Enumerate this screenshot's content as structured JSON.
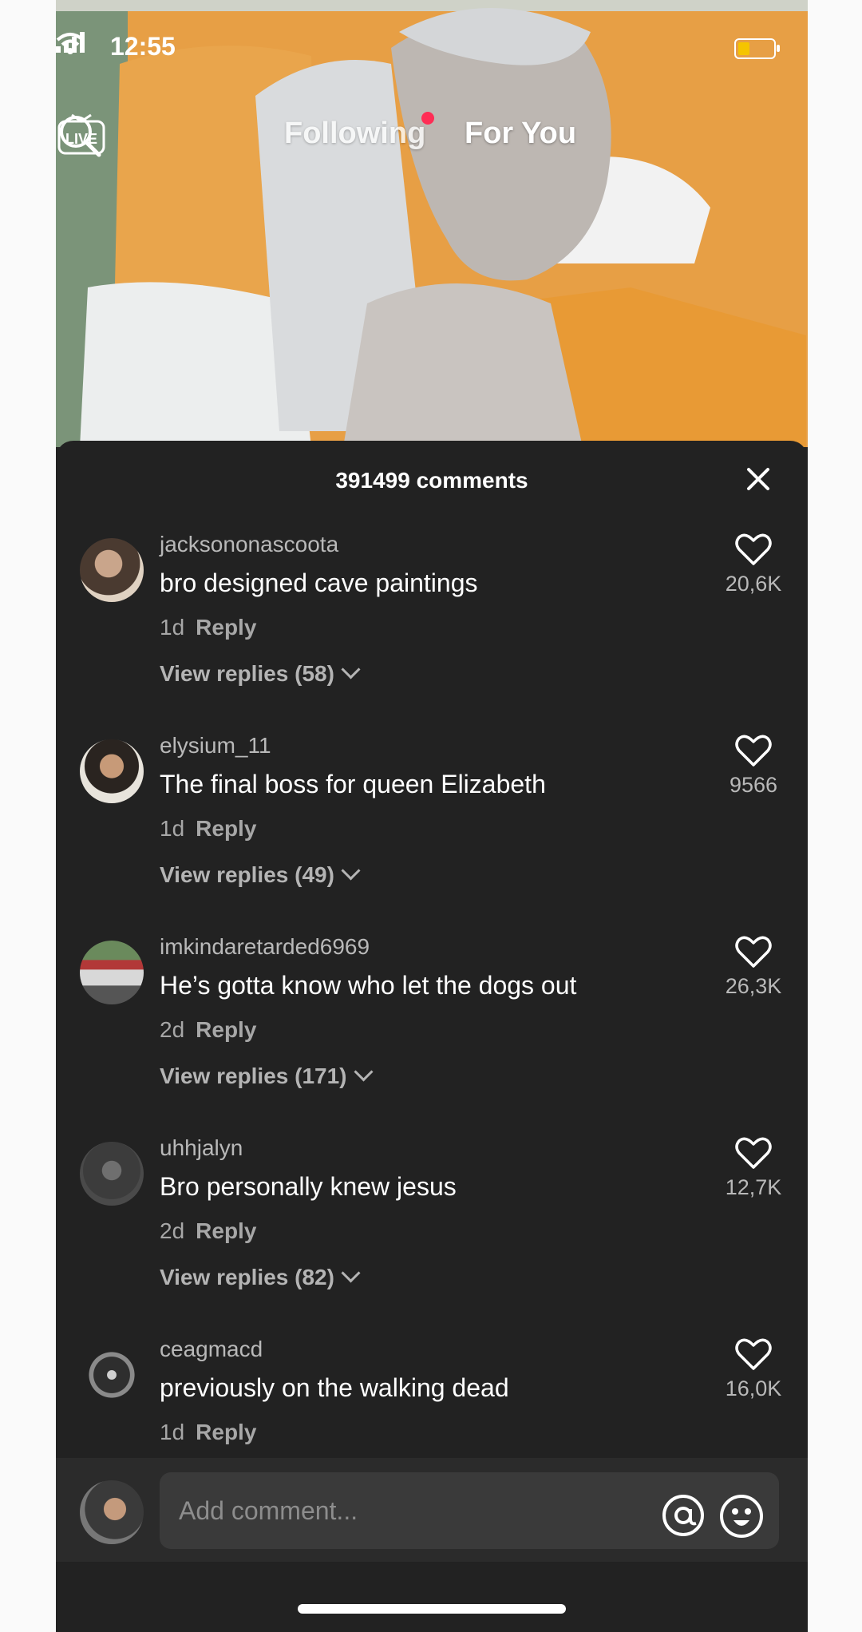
{
  "status_bar": {
    "time": "12:55"
  },
  "top_nav": {
    "live_label": "LIVE",
    "tabs": [
      {
        "label": "Following",
        "active": false
      },
      {
        "label": "For You",
        "active": true
      }
    ]
  },
  "comments_sheet": {
    "count_text": "391499 comments",
    "comments": [
      {
        "username": "jacksononascoota",
        "text": "bro designed cave paintings",
        "age": "1d",
        "reply_label": "Reply",
        "view_replies": "View replies (58)",
        "likes": "20,6K"
      },
      {
        "username": "elysium_11",
        "text": "The final boss for queen Elizabeth",
        "age": "1d",
        "reply_label": "Reply",
        "view_replies": "View replies (49)",
        "likes": "9566"
      },
      {
        "username": "imkindaretarded6969",
        "text": "He’s gotta know who let the dogs out",
        "age": "2d",
        "reply_label": "Reply",
        "view_replies": "View replies (171)",
        "likes": "26,3K"
      },
      {
        "username": "uhhjalyn",
        "text": "Bro personally knew jesus",
        "age": "2d",
        "reply_label": "Reply",
        "view_replies": "View replies (82)",
        "likes": "12,7K"
      },
      {
        "username": "ceagmacd",
        "text": "previously on the walking dead",
        "age": "1d",
        "reply_label": "Reply",
        "likes": "16,0K"
      }
    ]
  },
  "comment_input": {
    "placeholder": "Add comment..."
  },
  "colors": {
    "sheet_bg": "#222222",
    "live_dot": "#ff2d55",
    "battery": "#f5c400"
  }
}
